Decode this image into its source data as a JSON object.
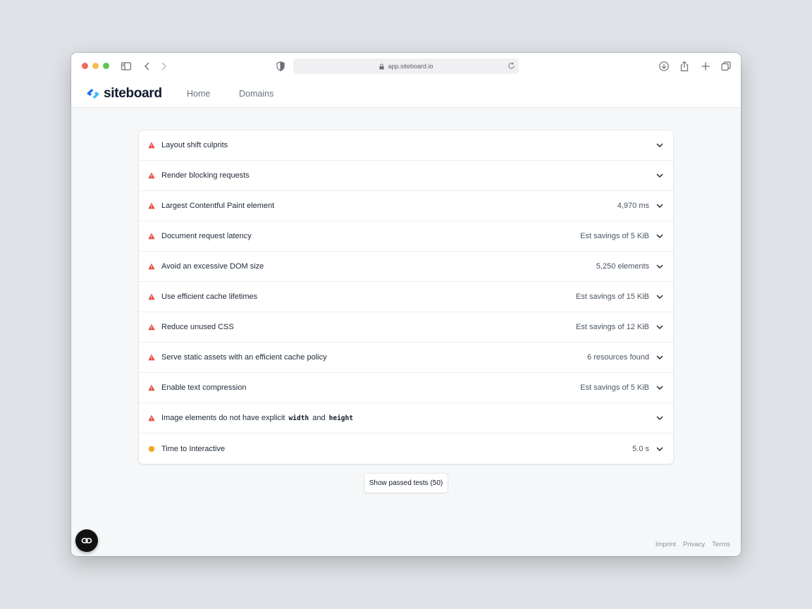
{
  "browser": {
    "url": "app.siteboard.io"
  },
  "site": {
    "brand": "siteboard",
    "nav": [
      {
        "label": "Home"
      },
      {
        "label": "Domains"
      }
    ]
  },
  "colors": {
    "warning": "#e5483d",
    "notice": "#f5a623",
    "brand_blue": "#1d6fe0",
    "brand_cyan": "#38bdf8"
  },
  "audits": [
    {
      "title": "Layout shift culprits",
      "meta": "",
      "status": "warning"
    },
    {
      "title": "Render blocking requests",
      "meta": "",
      "status": "warning"
    },
    {
      "title": "Largest Contentful Paint element",
      "meta": "4,970 ms",
      "status": "warning"
    },
    {
      "title": "Document request latency",
      "meta": "Est savings of 5 KiB",
      "status": "warning"
    },
    {
      "title": "Avoid an excessive DOM size",
      "meta": "5,250 elements",
      "status": "warning"
    },
    {
      "title": "Use efficient cache lifetimes",
      "meta": "Est savings of 15 KiB",
      "status": "warning"
    },
    {
      "title": "Reduce unused CSS",
      "meta": "Est savings of 12 KiB",
      "status": "warning"
    },
    {
      "title": "Serve static assets with an efficient cache policy",
      "meta": "6 resources found",
      "status": "warning"
    },
    {
      "title": "Enable text compression",
      "meta": "Est savings of 5 KiB",
      "status": "warning"
    },
    {
      "title_parts": [
        "Image elements do not have explicit ",
        "width",
        " and ",
        "height"
      ],
      "meta": "",
      "status": "warning"
    },
    {
      "title": "Time to Interactive",
      "meta": "5.0 s",
      "status": "notice"
    }
  ],
  "show_passed_label": "Show passed tests (50)",
  "footer": {
    "links": [
      "Imprint",
      "Privacy",
      "Terms"
    ]
  }
}
